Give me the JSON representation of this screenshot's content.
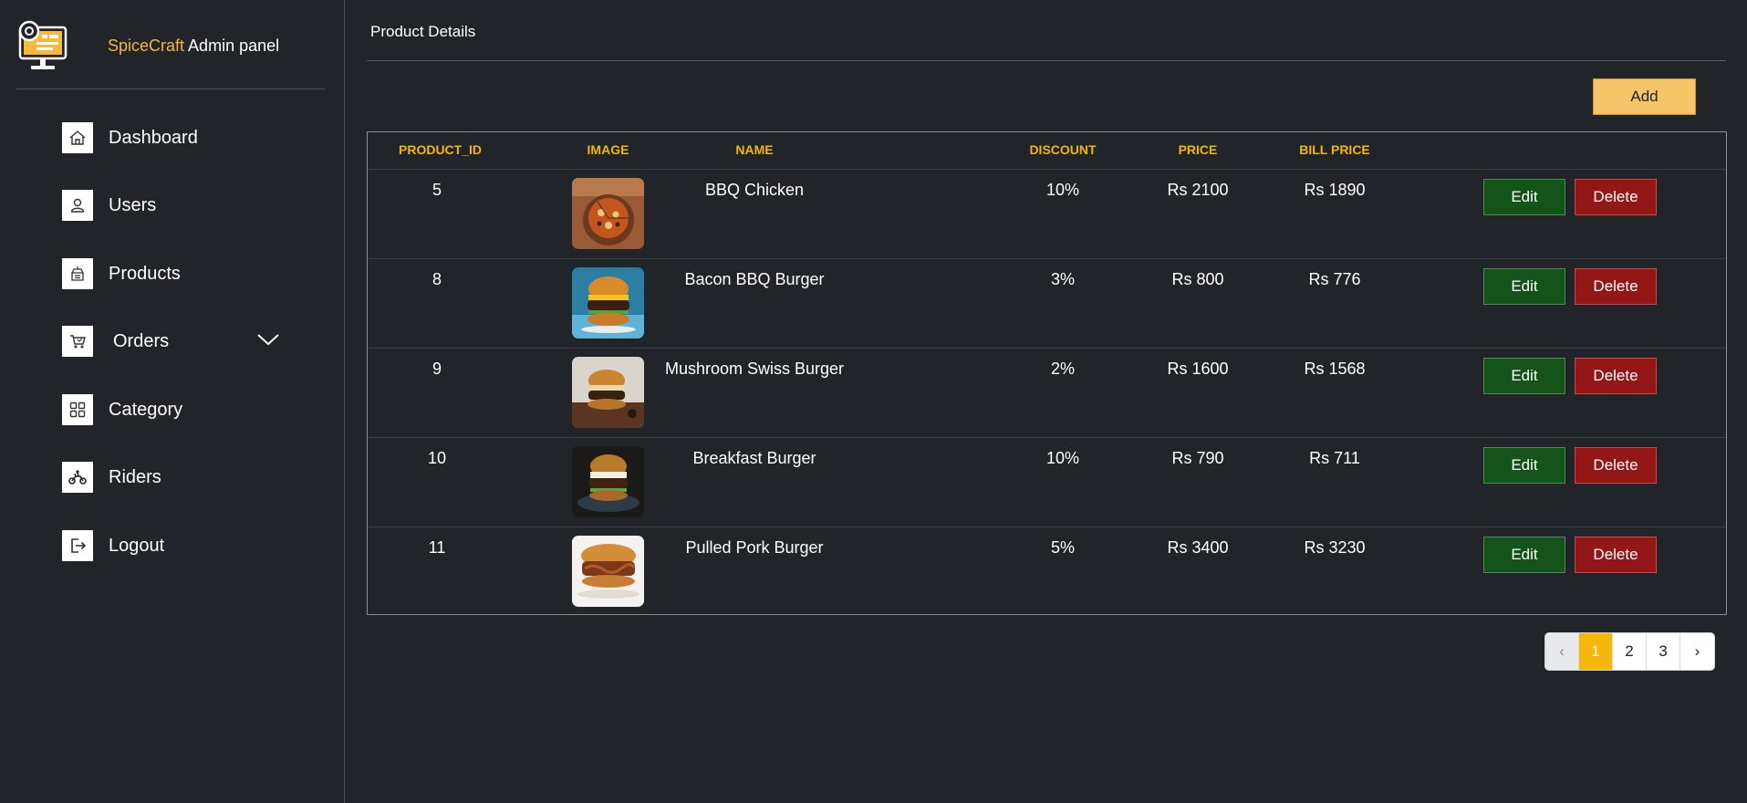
{
  "brand": {
    "accent": "SpiceCraft",
    "rest": " Admin panel"
  },
  "nav": [
    {
      "label": "Dashboard",
      "icon": "home-icon"
    },
    {
      "label": "Users",
      "icon": "user-icon"
    },
    {
      "label": "Products",
      "icon": "products-icon"
    },
    {
      "label": "Orders",
      "icon": "cart-icon"
    },
    {
      "label": "Category",
      "icon": "grid-icon"
    },
    {
      "label": "Riders",
      "icon": "motorbike-icon"
    },
    {
      "label": "Logout",
      "icon": "logout-icon"
    }
  ],
  "main": {
    "title": "Product Details",
    "add_label": "Add",
    "table": {
      "headers": [
        "PRODUCT_ID",
        "IMAGE",
        "NAME",
        "DISCOUNT",
        "PRICE",
        "BILL PRICE"
      ],
      "rows": [
        {
          "id": "5",
          "name": "BBQ Chicken",
          "discount": "10%",
          "price": "Rs 2100",
          "bill": "Rs 1890",
          "image": "pizza-photo"
        },
        {
          "id": "8",
          "name": "Bacon BBQ Burger",
          "discount": "3%",
          "price": "Rs 800",
          "bill": "Rs 776",
          "image": "burger-photo"
        },
        {
          "id": "9",
          "name": "Mushroom Swiss Burger",
          "discount": "2%",
          "price": "Rs 1600",
          "bill": "Rs 1568",
          "image": "burger-photo"
        },
        {
          "id": "10",
          "name": "Breakfast Burger",
          "discount": "10%",
          "price": "Rs 790",
          "bill": "Rs 711",
          "image": "burger-photo"
        },
        {
          "id": "11",
          "name": "Pulled Pork Burger",
          "discount": "5%",
          "price": "Rs 3400",
          "bill": "Rs 3230",
          "image": "burger-photo"
        }
      ],
      "edit_label": "Edit",
      "delete_label": "Delete"
    },
    "pagination": {
      "prev": "‹",
      "pages": [
        "1",
        "2",
        "3"
      ],
      "current": "1",
      "next": "›"
    }
  },
  "colors": {
    "background": "#212429",
    "accent": "#f2b705",
    "edit": "#14531a",
    "delete": "#941717",
    "add": "#f6c56a"
  }
}
